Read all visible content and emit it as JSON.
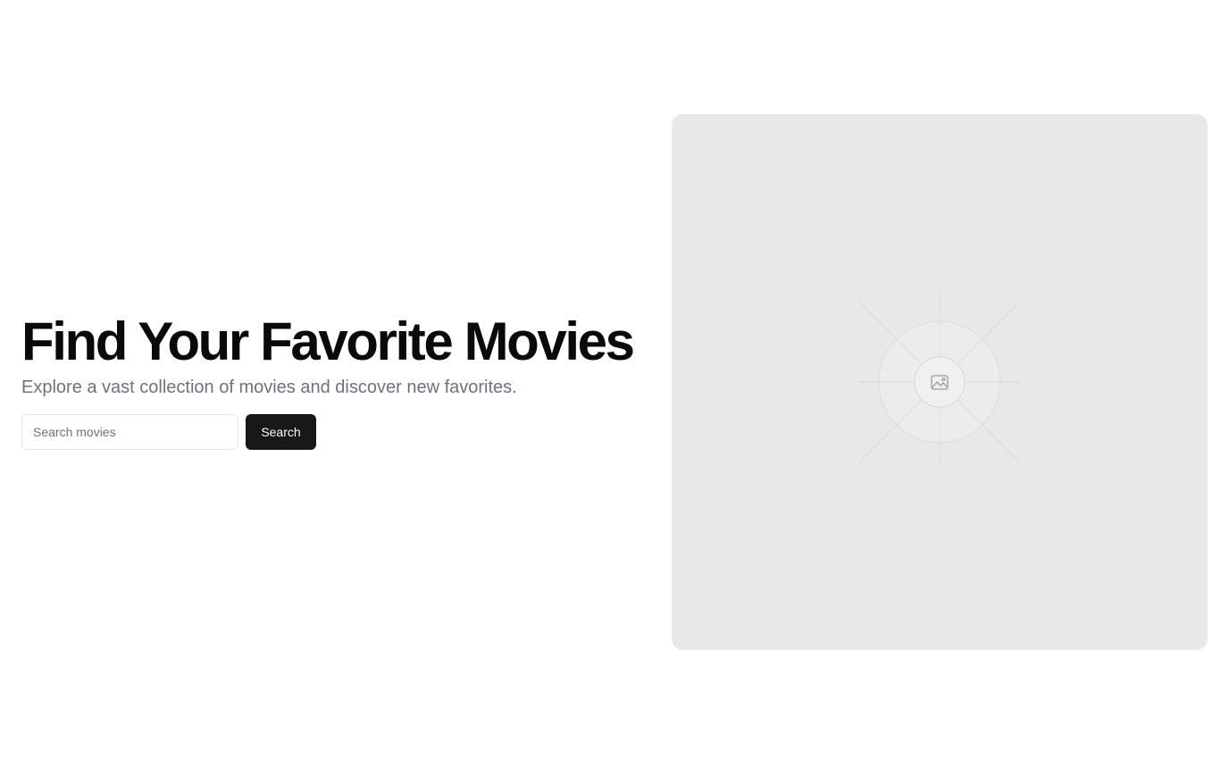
{
  "hero": {
    "title": "Find Your Favorite Movies",
    "subtitle": "Explore a vast collection of movies and discover new favorites."
  },
  "search": {
    "placeholder": "Search movies",
    "value": "",
    "button_label": "Search"
  },
  "image": {
    "icon": "image-placeholder-icon"
  },
  "colors": {
    "title": "#0a0a0a",
    "subtitle": "#6b7280",
    "button_bg": "#18181b",
    "button_text": "#fafafa",
    "image_bg": "#e8e8e8"
  }
}
